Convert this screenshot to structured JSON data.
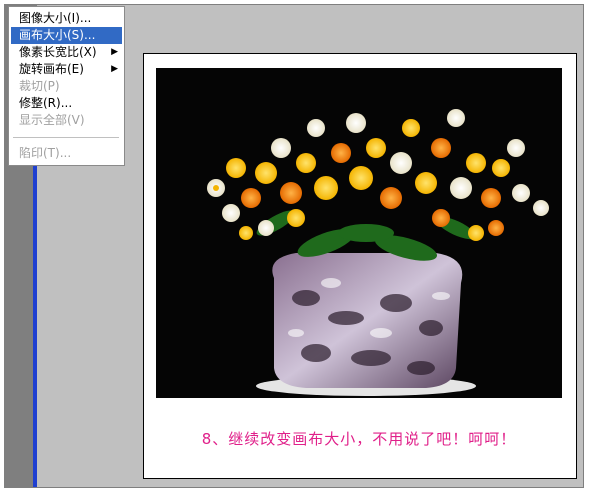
{
  "menu": {
    "items": [
      {
        "label": "图像大小(I)..."
      },
      {
        "label": "画布大小(S)..."
      },
      {
        "label": "像素长宽比(X)"
      },
      {
        "label": "旋转画布(E)"
      },
      {
        "label": "裁切(P)"
      },
      {
        "label": "修整(R)..."
      },
      {
        "label": "显示全部(V)"
      },
      {
        "label": "陷印(T)..."
      }
    ],
    "submenu_arrow": "▶"
  },
  "canvas": {
    "caption": "8、继续改变画布大小，不用说了吧！呵呵！"
  }
}
